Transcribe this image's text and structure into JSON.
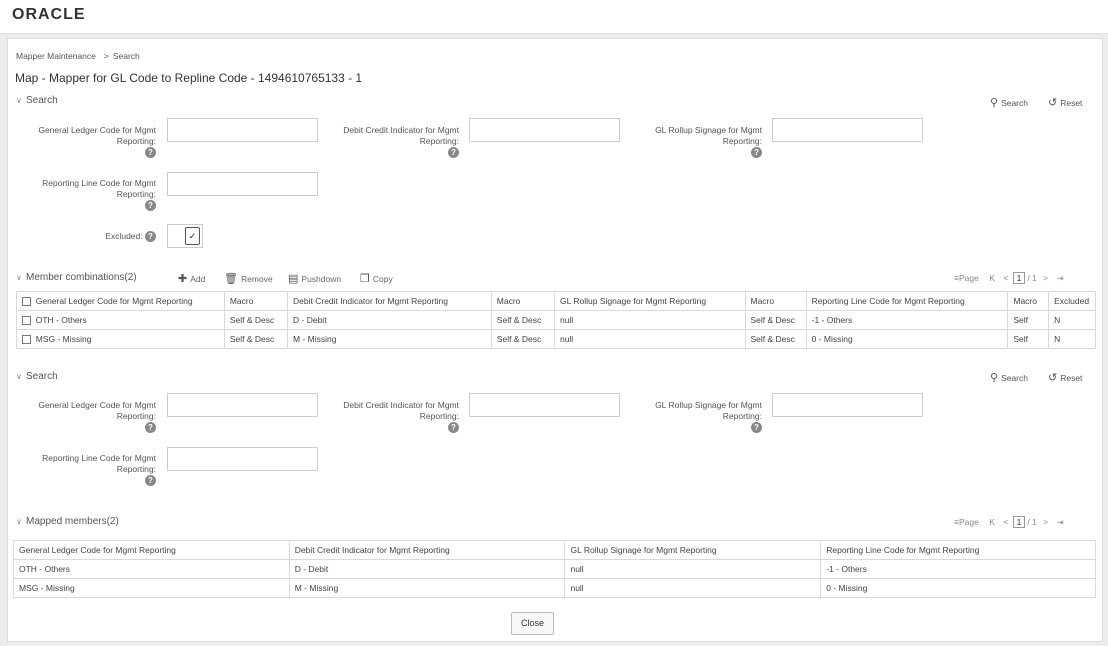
{
  "brand": {
    "logo_text": "ORACLE"
  },
  "breadcrumb": {
    "items": [
      "Mapper Maintenance",
      "Search"
    ],
    "separator": ">"
  },
  "page_title": "Map - Mapper for GL Code to Repline Code - 1494610765133 - 1",
  "search1": {
    "title": "Search",
    "search_label": "Search",
    "reset_label": "Reset",
    "fields": {
      "gl_code": {
        "label": "General Ledger Code for Mgmt Reporting:",
        "value": ""
      },
      "dci": {
        "label": "Debit Credit Indicator for Mgmt Reporting:",
        "value": ""
      },
      "rollup": {
        "label": "GL Rollup Signage for Mgmt Reporting:",
        "value": ""
      },
      "repline": {
        "label": "Reporting Line Code for Mgmt Reporting:",
        "value": ""
      },
      "excluded": {
        "label": "Excluded:",
        "value": ""
      }
    }
  },
  "member_combinations": {
    "title": "Member combinations(2)",
    "toolbar": {
      "add": "Add",
      "remove": "Remove",
      "pushdown": "Pushdown",
      "copy": "Copy"
    },
    "pager": {
      "label": "Page",
      "current": "1",
      "total": "/ 1"
    },
    "columns": [
      "General Ledger Code for Mgmt Reporting",
      "Macro",
      "Debit Credit Indicator for Mgmt Reporting",
      "Macro",
      "GL Rollup Signage for Mgmt Reporting",
      "Macro",
      "Reporting Line Code for Mgmt Reporting",
      "Macro",
      "Excluded"
    ],
    "rows": [
      [
        "OTH - Others",
        "Self & Desc",
        "D - Debit",
        "Self & Desc",
        "null",
        "Self & Desc",
        "-1 - Others",
        "Self",
        "N"
      ],
      [
        "MSG - Missing",
        "Self & Desc",
        "M - Missing",
        "Self & Desc",
        "null",
        "Self & Desc",
        "0 - Missing",
        "Self",
        "N"
      ]
    ]
  },
  "search2": {
    "title": "Search",
    "search_label": "Search",
    "reset_label": "Reset",
    "fields": {
      "gl_code": {
        "label": "General Ledger Code for Mgmt Reporting:",
        "value": ""
      },
      "dci": {
        "label": "Debit Credit Indicator for Mgmt Reporting:",
        "value": ""
      },
      "rollup": {
        "label": "GL Rollup Signage for Mgmt Reporting:",
        "value": ""
      },
      "repline": {
        "label": "Reporting Line Code for Mgmt Reporting:",
        "value": ""
      }
    }
  },
  "mapped_members": {
    "title": "Mapped members(2)",
    "pager": {
      "label": "Page",
      "current": "1",
      "total": "/ 1"
    },
    "columns": [
      "General Ledger Code for Mgmt Reporting",
      "Debit Credit Indicator for Mgmt Reporting",
      "GL Rollup Signage for Mgmt Reporting",
      "Reporting Line Code for Mgmt Reporting"
    ],
    "rows": [
      [
        "OTH - Others",
        "D - Debit",
        "null",
        "-1 - Others"
      ],
      [
        "MSG - Missing",
        "M - Missing",
        "null",
        "0 - Missing"
      ]
    ]
  },
  "close_label": "Close"
}
